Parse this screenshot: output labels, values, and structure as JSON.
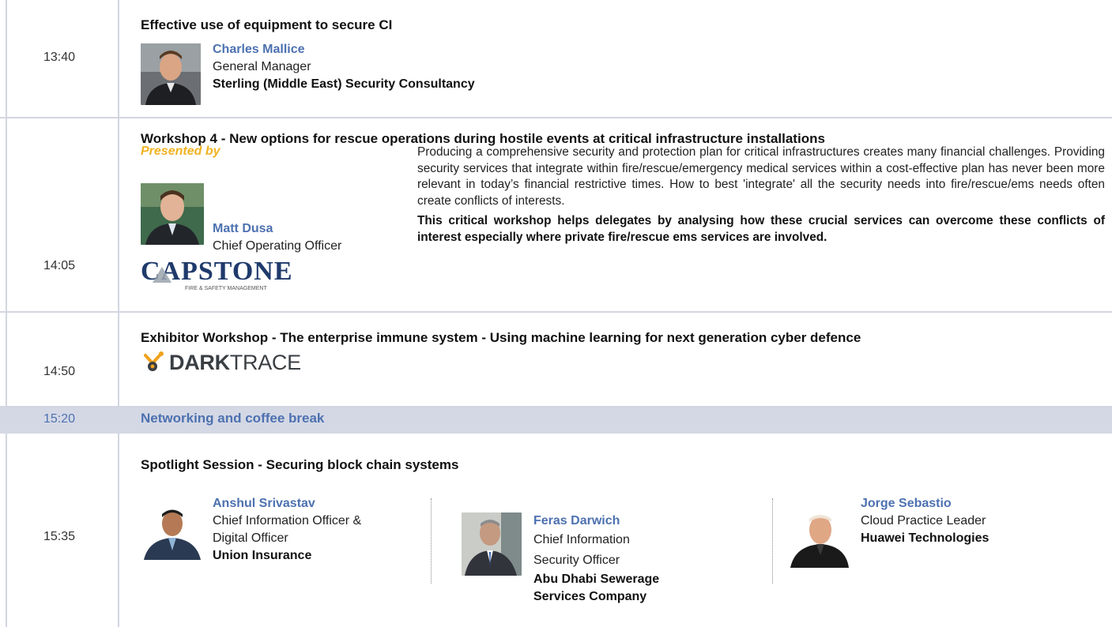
{
  "rows": [
    {
      "time": "13:40",
      "title": "Effective use of equipment to secure CI",
      "speaker": {
        "name": "Charles Mallice",
        "role": "General Manager",
        "org": "Sterling (Middle East) Security Consultancy",
        "photo": "speaker-photo"
      }
    },
    {
      "time": "14:05",
      "title": "Workshop 4 - New options for rescue operations during hostile events at critical infrastructure installations",
      "presented_by": "Presented by",
      "speaker": {
        "name": "Matt Dusa",
        "role": "Chief Operating Officer",
        "photo": "speaker-photo"
      },
      "logo": {
        "name": "CAPSTONE",
        "sub": "FIRE & SAFETY MANAGEMENT"
      },
      "description": [
        "Producing a comprehensive security and protection plan for critical infrastructures creates many financial challenges. Providing security services that integrate within fire/rescue/emergency medical services within a cost-effective plan has never been more relevant in today’s financial restrictive times. How to best 'integrate' all the security needs into fire/rescue/ems needs often create conflicts of interests.",
        "This critical workshop helps delegates by analysing how these crucial services can overcome these conflicts of interest especially where private fire/rescue ems services are involved."
      ]
    },
    {
      "time": "14:50",
      "title": "Exhibitor Workshop - The enterprise immune system - Using machine learning for next generation cyber defence",
      "logo": {
        "bold": "DARK",
        "light": "TRACE"
      }
    },
    {
      "time": "15:20",
      "title": "Networking and coffee break"
    },
    {
      "time": "15:35",
      "title": "Spotlight Session - Securing block chain systems",
      "speakers": [
        {
          "name": "Anshul Srivastav",
          "role_lines": [
            "Chief Information Officer &",
            "Digital Officer"
          ],
          "org_lines": [
            "Union Insurance"
          ]
        },
        {
          "name": "Feras Darwich",
          "role_lines": [
            "Chief Information",
            "Security Officer"
          ],
          "org_lines": [
            "Abu Dhabi Sewerage",
            "Services Company"
          ]
        },
        {
          "name": "Jorge Sebastio",
          "role_lines": [
            "Cloud Practice Leader"
          ],
          "org_lines": [
            "Huawei Technologies"
          ]
        }
      ]
    }
  ],
  "colors": {
    "accent_blue": "#4d71b0",
    "accent_yellow": "#f0b323",
    "border": "#d3d6e0",
    "break_band": "#d4d8e5"
  }
}
